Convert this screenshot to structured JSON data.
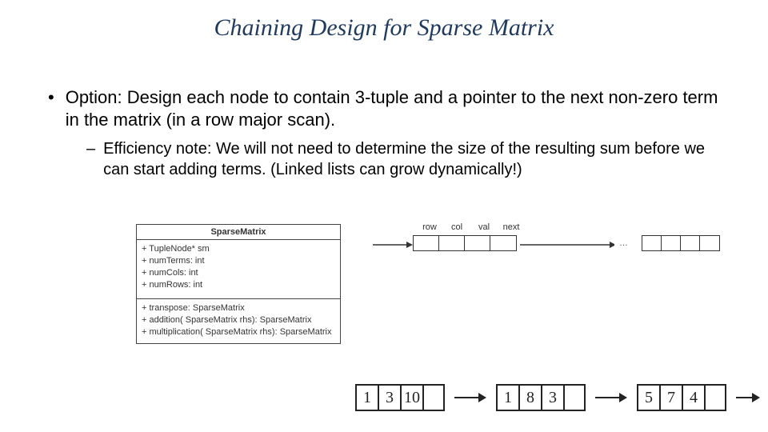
{
  "title": "Chaining Design for Sparse Matrix",
  "bullets": {
    "main": "Option: Design each node to contain 3-tuple and a pointer to the next non-zero term in the matrix (in a row major scan).",
    "sub": "Efficiency note: We will not need to determine the size of the resulting sum before we can start adding terms. (Linked lists can grow dynamically!)"
  },
  "uml": {
    "class_name": "SparseMatrix",
    "attrs": [
      "+ TupleNode* sm",
      "+ numTerms: int",
      "+ numCols: int",
      "+ numRows: int"
    ],
    "ops": [
      "+ transpose: SparseMatrix",
      "+ addition( SparseMatrix rhs): SparseMatrix",
      "+ multiplication( SparseMatrix rhs): SparseMatrix"
    ]
  },
  "node_labels": [
    "row",
    "col",
    "val",
    "next"
  ],
  "ellipsis": "…",
  "hand_nodes": [
    [
      "1",
      "3",
      "10",
      ""
    ],
    [
      "1",
      "8",
      "3",
      ""
    ],
    [
      "5",
      "7",
      "4",
      ""
    ]
  ]
}
